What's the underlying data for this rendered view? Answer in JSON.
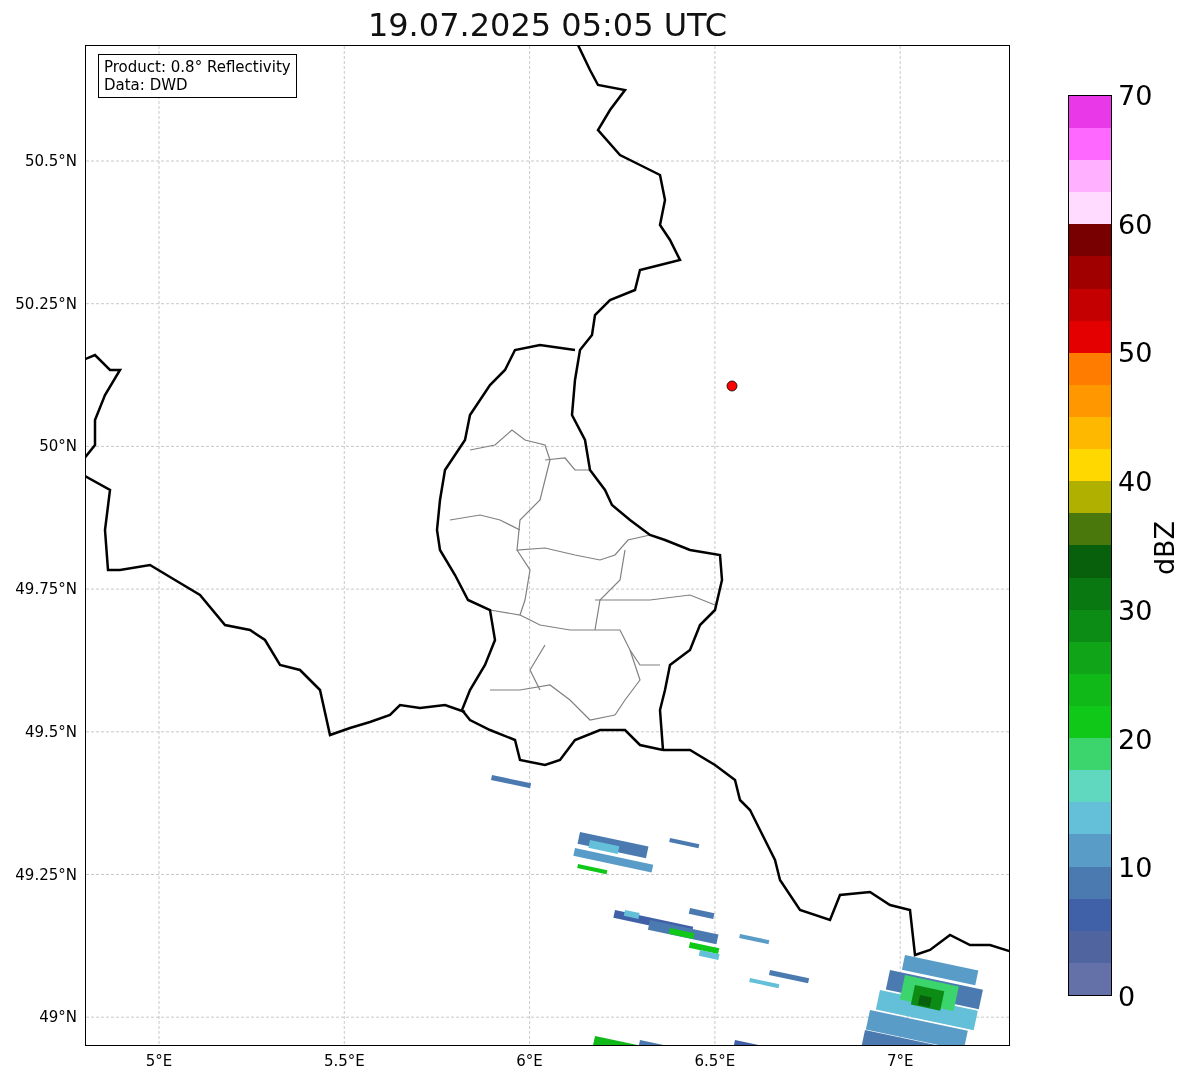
{
  "title": "19.07.2025 05:05 UTC",
  "legend": [
    "Product: 0.8° Reflectivity",
    "Data: DWD"
  ],
  "lat_ticks": [
    "50.5°N",
    "50.25°N",
    "50°N",
    "49.75°N",
    "49.5°N",
    "49.25°N",
    "49°N"
  ],
  "lon_ticks": [
    "5°E",
    "5.5°E",
    "6°E",
    "6.5°E",
    "7°E"
  ],
  "colorbar": {
    "label": "dBZ",
    "ticks": [
      "70",
      "60",
      "50",
      "40",
      "30",
      "20",
      "10",
      "0"
    ],
    "segments": [
      {
        "color": "#6470a8"
      },
      {
        "color": "#5064a0"
      },
      {
        "color": "#4060a8"
      },
      {
        "color": "#4a7ab0"
      },
      {
        "color": "#5a9cc8"
      },
      {
        "color": "#64c0d8"
      },
      {
        "color": "#60d8c0"
      },
      {
        "color": "#3cd46c"
      },
      {
        "color": "#10c818"
      },
      {
        "color": "#10b818"
      },
      {
        "color": "#10a418"
      },
      {
        "color": "#0c8c14"
      },
      {
        "color": "#0a7810"
      },
      {
        "color": "#08600c"
      },
      {
        "color": "#4a780c"
      },
      {
        "color": "#b0b000"
      },
      {
        "color": "#ffd800"
      },
      {
        "color": "#ffb800"
      },
      {
        "color": "#ff9800"
      },
      {
        "color": "#ff7c00"
      },
      {
        "color": "#e40000"
      },
      {
        "color": "#c40000"
      },
      {
        "color": "#a00000"
      },
      {
        "color": "#780000"
      },
      {
        "color": "#ffdcff"
      },
      {
        "color": "#ffb0ff"
      },
      {
        "color": "#ff68ff"
      },
      {
        "color": "#e838e8"
      }
    ]
  }
}
